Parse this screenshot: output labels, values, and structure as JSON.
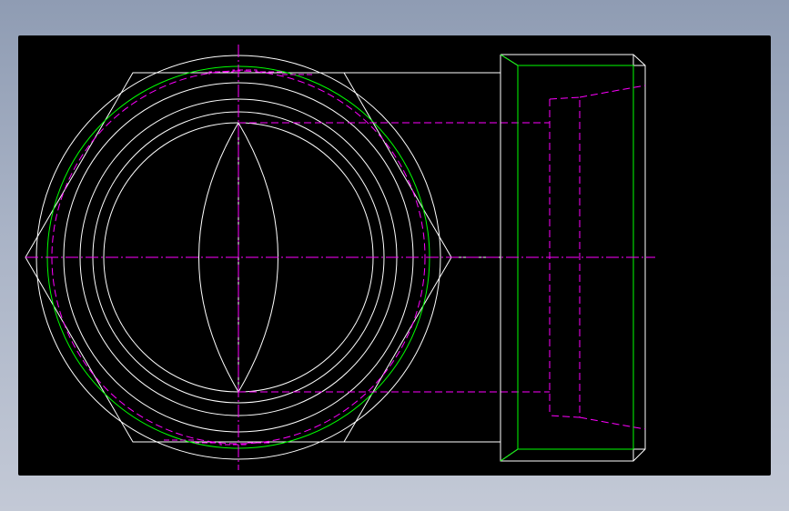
{
  "viewer": {
    "background": "#000000",
    "frame_gradient_top": "#8f9cb3",
    "frame_gradient_bottom": "#c3c9d6"
  },
  "drawing": {
    "type": "cad-two-view",
    "views": [
      "front-view-circular",
      "side-view-section"
    ],
    "line_colors": {
      "outline": "#ffffff",
      "thread": "#00ff00",
      "hidden": "#ff00ff",
      "centerline": "#ff00ff"
    }
  }
}
